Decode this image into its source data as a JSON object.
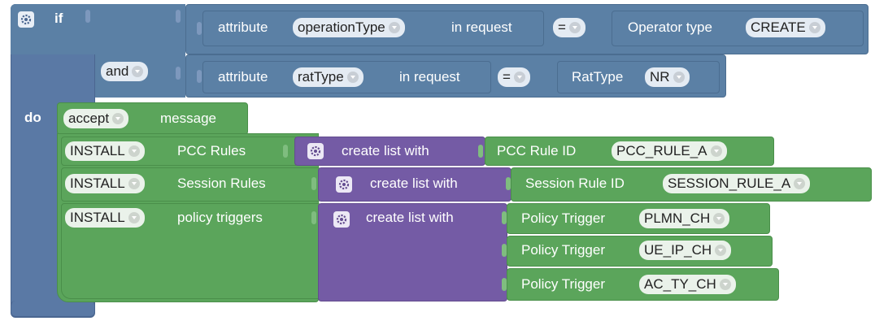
{
  "if_block": {
    "if_label": "if",
    "and_label": "and",
    "do_label": "do",
    "gear_icon": "gear-icon"
  },
  "condition1": {
    "attr_prefix": "attribute",
    "attr_field": "operationType",
    "attr_suffix": "in request",
    "op": "=",
    "value_label": "Operator type",
    "value_field": "CREATE"
  },
  "condition2": {
    "attr_prefix": "attribute",
    "attr_field": "ratType",
    "attr_suffix": "in request",
    "op": "=",
    "value_label": "RatType",
    "value_field": "NR"
  },
  "action": {
    "verb_field": "accept",
    "message_label": "message",
    "rows": [
      {
        "verb": "INSTALL",
        "label": "PCC Rules",
        "list_label": "create list with",
        "items": [
          {
            "label": "PCC Rule ID",
            "value": "PCC_RULE_A"
          }
        ]
      },
      {
        "verb": "INSTALL",
        "label": "Session Rules",
        "list_label": "create list with",
        "items": [
          {
            "label": "Session Rule ID",
            "value": "SESSION_RULE_A"
          }
        ]
      },
      {
        "verb": "INSTALL",
        "label": "policy triggers",
        "list_label": "create list with",
        "items": [
          {
            "label": "Policy Trigger",
            "value": "PLMN_CH"
          },
          {
            "label": "Policy Trigger",
            "value": "UE_IP_CH"
          },
          {
            "label": "Policy Trigger",
            "value": "AC_TY_CH"
          }
        ]
      }
    ]
  },
  "colors": {
    "logic": "#5b80a5",
    "action": "#5ba55b",
    "list": "#745ba5"
  }
}
